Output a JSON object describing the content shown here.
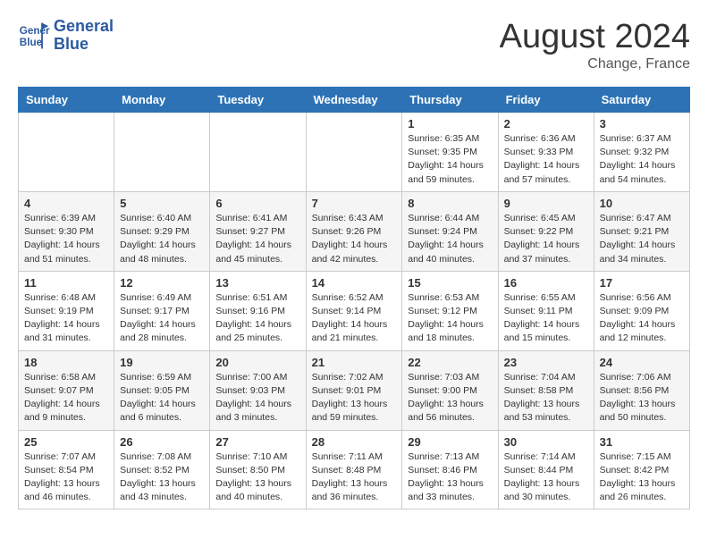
{
  "header": {
    "logo_line1": "General",
    "logo_line2": "Blue",
    "main_title": "August 2024",
    "sub_title": "Change, France"
  },
  "weekdays": [
    "Sunday",
    "Monday",
    "Tuesday",
    "Wednesday",
    "Thursday",
    "Friday",
    "Saturday"
  ],
  "weeks": [
    [
      {
        "day": "",
        "info": ""
      },
      {
        "day": "",
        "info": ""
      },
      {
        "day": "",
        "info": ""
      },
      {
        "day": "",
        "info": ""
      },
      {
        "day": "1",
        "info": "Sunrise: 6:35 AM\nSunset: 9:35 PM\nDaylight: 14 hours\nand 59 minutes."
      },
      {
        "day": "2",
        "info": "Sunrise: 6:36 AM\nSunset: 9:33 PM\nDaylight: 14 hours\nand 57 minutes."
      },
      {
        "day": "3",
        "info": "Sunrise: 6:37 AM\nSunset: 9:32 PM\nDaylight: 14 hours\nand 54 minutes."
      }
    ],
    [
      {
        "day": "4",
        "info": "Sunrise: 6:39 AM\nSunset: 9:30 PM\nDaylight: 14 hours\nand 51 minutes."
      },
      {
        "day": "5",
        "info": "Sunrise: 6:40 AM\nSunset: 9:29 PM\nDaylight: 14 hours\nand 48 minutes."
      },
      {
        "day": "6",
        "info": "Sunrise: 6:41 AM\nSunset: 9:27 PM\nDaylight: 14 hours\nand 45 minutes."
      },
      {
        "day": "7",
        "info": "Sunrise: 6:43 AM\nSunset: 9:26 PM\nDaylight: 14 hours\nand 42 minutes."
      },
      {
        "day": "8",
        "info": "Sunrise: 6:44 AM\nSunset: 9:24 PM\nDaylight: 14 hours\nand 40 minutes."
      },
      {
        "day": "9",
        "info": "Sunrise: 6:45 AM\nSunset: 9:22 PM\nDaylight: 14 hours\nand 37 minutes."
      },
      {
        "day": "10",
        "info": "Sunrise: 6:47 AM\nSunset: 9:21 PM\nDaylight: 14 hours\nand 34 minutes."
      }
    ],
    [
      {
        "day": "11",
        "info": "Sunrise: 6:48 AM\nSunset: 9:19 PM\nDaylight: 14 hours\nand 31 minutes."
      },
      {
        "day": "12",
        "info": "Sunrise: 6:49 AM\nSunset: 9:17 PM\nDaylight: 14 hours\nand 28 minutes."
      },
      {
        "day": "13",
        "info": "Sunrise: 6:51 AM\nSunset: 9:16 PM\nDaylight: 14 hours\nand 25 minutes."
      },
      {
        "day": "14",
        "info": "Sunrise: 6:52 AM\nSunset: 9:14 PM\nDaylight: 14 hours\nand 21 minutes."
      },
      {
        "day": "15",
        "info": "Sunrise: 6:53 AM\nSunset: 9:12 PM\nDaylight: 14 hours\nand 18 minutes."
      },
      {
        "day": "16",
        "info": "Sunrise: 6:55 AM\nSunset: 9:11 PM\nDaylight: 14 hours\nand 15 minutes."
      },
      {
        "day": "17",
        "info": "Sunrise: 6:56 AM\nSunset: 9:09 PM\nDaylight: 14 hours\nand 12 minutes."
      }
    ],
    [
      {
        "day": "18",
        "info": "Sunrise: 6:58 AM\nSunset: 9:07 PM\nDaylight: 14 hours\nand 9 minutes."
      },
      {
        "day": "19",
        "info": "Sunrise: 6:59 AM\nSunset: 9:05 PM\nDaylight: 14 hours\nand 6 minutes."
      },
      {
        "day": "20",
        "info": "Sunrise: 7:00 AM\nSunset: 9:03 PM\nDaylight: 14 hours\nand 3 minutes."
      },
      {
        "day": "21",
        "info": "Sunrise: 7:02 AM\nSunset: 9:01 PM\nDaylight: 13 hours\nand 59 minutes."
      },
      {
        "day": "22",
        "info": "Sunrise: 7:03 AM\nSunset: 9:00 PM\nDaylight: 13 hours\nand 56 minutes."
      },
      {
        "day": "23",
        "info": "Sunrise: 7:04 AM\nSunset: 8:58 PM\nDaylight: 13 hours\nand 53 minutes."
      },
      {
        "day": "24",
        "info": "Sunrise: 7:06 AM\nSunset: 8:56 PM\nDaylight: 13 hours\nand 50 minutes."
      }
    ],
    [
      {
        "day": "25",
        "info": "Sunrise: 7:07 AM\nSunset: 8:54 PM\nDaylight: 13 hours\nand 46 minutes."
      },
      {
        "day": "26",
        "info": "Sunrise: 7:08 AM\nSunset: 8:52 PM\nDaylight: 13 hours\nand 43 minutes."
      },
      {
        "day": "27",
        "info": "Sunrise: 7:10 AM\nSunset: 8:50 PM\nDaylight: 13 hours\nand 40 minutes."
      },
      {
        "day": "28",
        "info": "Sunrise: 7:11 AM\nSunset: 8:48 PM\nDaylight: 13 hours\nand 36 minutes."
      },
      {
        "day": "29",
        "info": "Sunrise: 7:13 AM\nSunset: 8:46 PM\nDaylight: 13 hours\nand 33 minutes."
      },
      {
        "day": "30",
        "info": "Sunrise: 7:14 AM\nSunset: 8:44 PM\nDaylight: 13 hours\nand 30 minutes."
      },
      {
        "day": "31",
        "info": "Sunrise: 7:15 AM\nSunset: 8:42 PM\nDaylight: 13 hours\nand 26 minutes."
      }
    ]
  ]
}
